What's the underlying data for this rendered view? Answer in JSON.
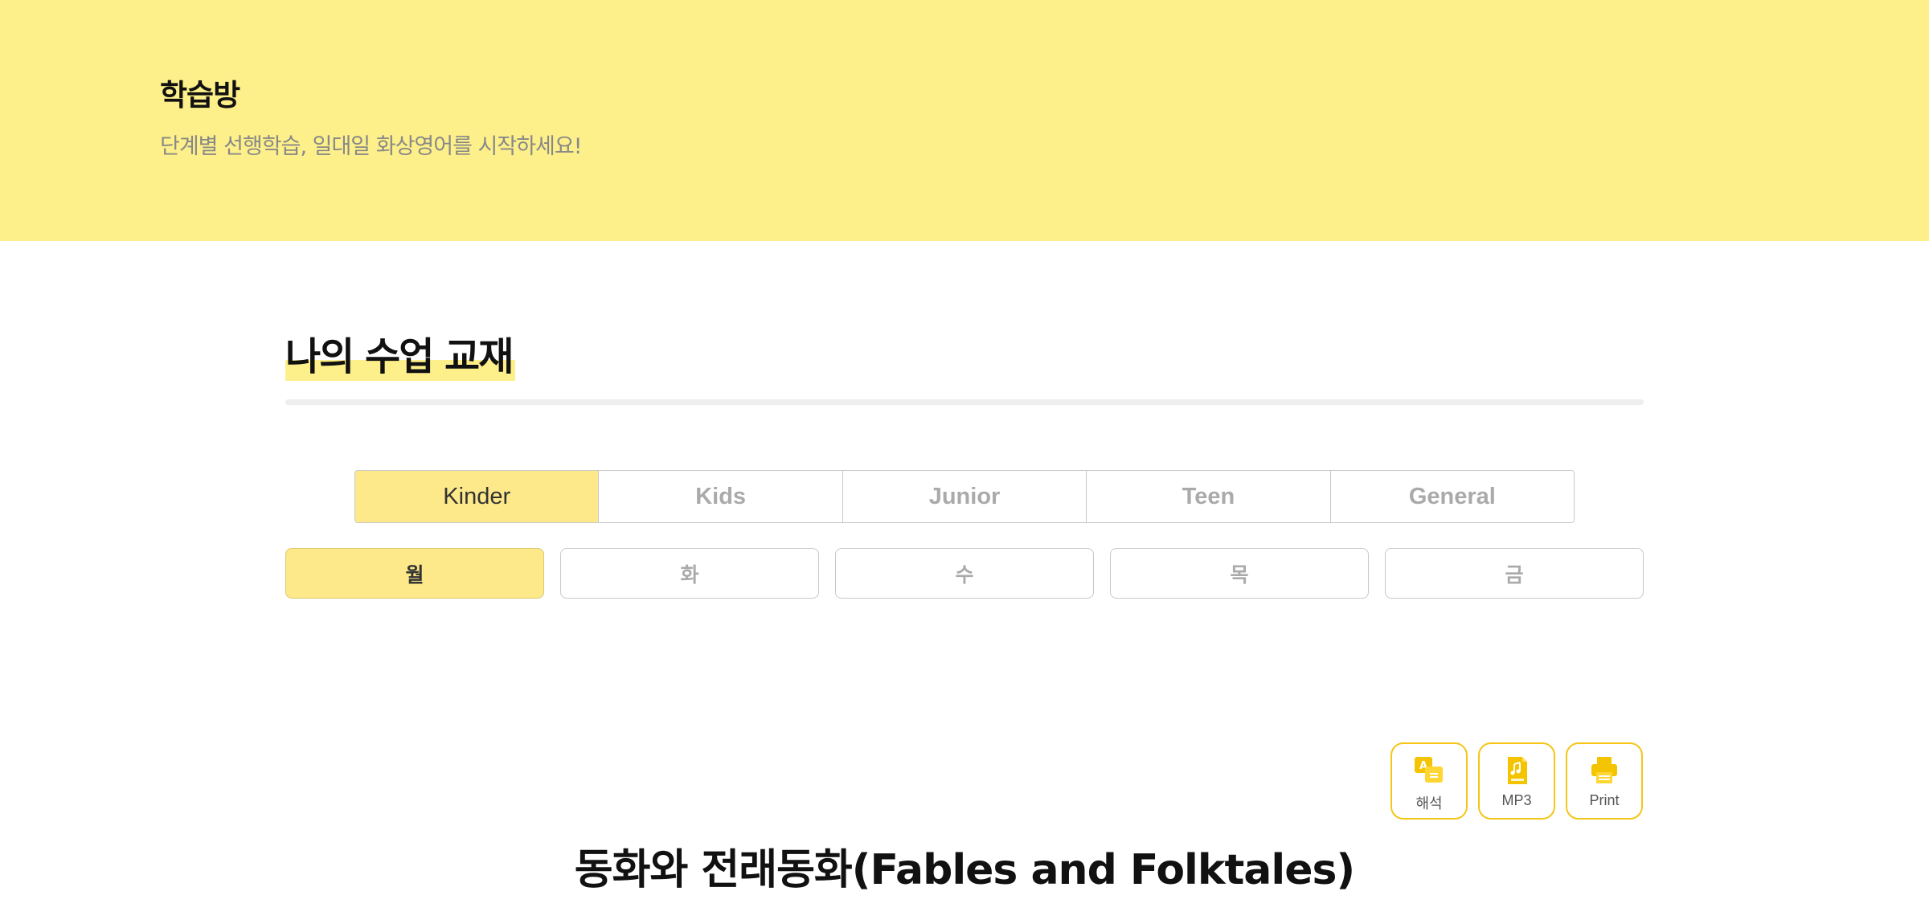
{
  "header": {
    "title": "학습방",
    "subtitle": "단계별 선행학습, 일대일 화상영어를 시작하세요!"
  },
  "section": {
    "title": "나의 수업 교재"
  },
  "level_tabs": {
    "active": "Kinder",
    "items": [
      {
        "label": "Kinder"
      },
      {
        "label": "Kids"
      },
      {
        "label": "Junior"
      },
      {
        "label": "Teen"
      },
      {
        "label": "General"
      }
    ]
  },
  "day_tabs": {
    "active": "월",
    "items": [
      {
        "label": "월"
      },
      {
        "label": "화"
      },
      {
        "label": "수"
      },
      {
        "label": "목"
      },
      {
        "label": "금"
      }
    ]
  },
  "actions": [
    {
      "label": "해석",
      "icon": "translate-icon"
    },
    {
      "label": "MP3",
      "icon": "mp3-file-icon"
    },
    {
      "label": "Print",
      "icon": "printer-icon"
    }
  ],
  "book": {
    "title": "동화와 전래동화(Fables and Folktales)"
  },
  "colors": {
    "hero_background": "#fdf08a",
    "active_tab": "#fde98a",
    "accent_border": "#f5c518",
    "icon_yellow": "#f5c400"
  }
}
